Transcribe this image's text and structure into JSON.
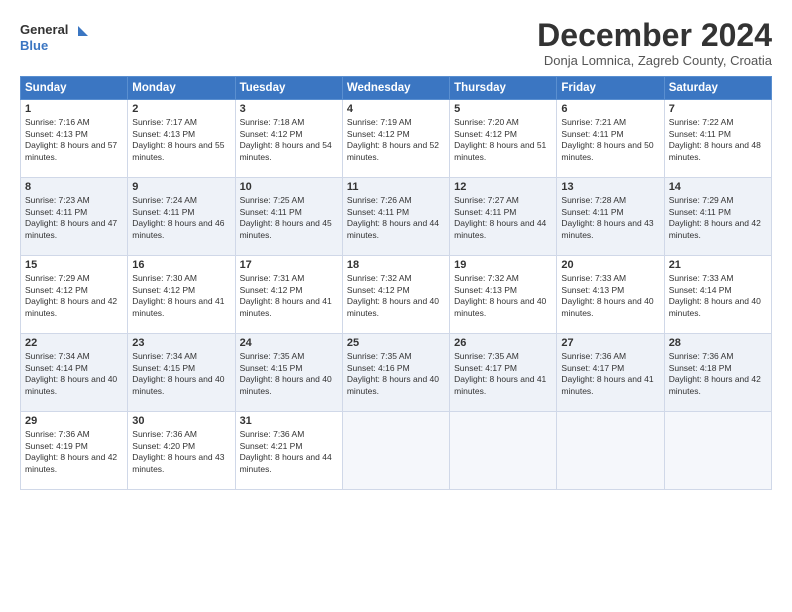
{
  "header": {
    "logo_line1": "General",
    "logo_line2": "Blue",
    "month_title": "December 2024",
    "location": "Donja Lomnica, Zagreb County, Croatia"
  },
  "weekdays": [
    "Sunday",
    "Monday",
    "Tuesday",
    "Wednesday",
    "Thursday",
    "Friday",
    "Saturday"
  ],
  "weeks": [
    [
      {
        "day": "1",
        "sunrise": "7:16 AM",
        "sunset": "4:13 PM",
        "daylight": "8 hours and 57 minutes."
      },
      {
        "day": "2",
        "sunrise": "7:17 AM",
        "sunset": "4:13 PM",
        "daylight": "8 hours and 55 minutes."
      },
      {
        "day": "3",
        "sunrise": "7:18 AM",
        "sunset": "4:12 PM",
        "daylight": "8 hours and 54 minutes."
      },
      {
        "day": "4",
        "sunrise": "7:19 AM",
        "sunset": "4:12 PM",
        "daylight": "8 hours and 52 minutes."
      },
      {
        "day": "5",
        "sunrise": "7:20 AM",
        "sunset": "4:12 PM",
        "daylight": "8 hours and 51 minutes."
      },
      {
        "day": "6",
        "sunrise": "7:21 AM",
        "sunset": "4:11 PM",
        "daylight": "8 hours and 50 minutes."
      },
      {
        "day": "7",
        "sunrise": "7:22 AM",
        "sunset": "4:11 PM",
        "daylight": "8 hours and 48 minutes."
      }
    ],
    [
      {
        "day": "8",
        "sunrise": "7:23 AM",
        "sunset": "4:11 PM",
        "daylight": "8 hours and 47 minutes."
      },
      {
        "day": "9",
        "sunrise": "7:24 AM",
        "sunset": "4:11 PM",
        "daylight": "8 hours and 46 minutes."
      },
      {
        "day": "10",
        "sunrise": "7:25 AM",
        "sunset": "4:11 PM",
        "daylight": "8 hours and 45 minutes."
      },
      {
        "day": "11",
        "sunrise": "7:26 AM",
        "sunset": "4:11 PM",
        "daylight": "8 hours and 44 minutes."
      },
      {
        "day": "12",
        "sunrise": "7:27 AM",
        "sunset": "4:11 PM",
        "daylight": "8 hours and 44 minutes."
      },
      {
        "day": "13",
        "sunrise": "7:28 AM",
        "sunset": "4:11 PM",
        "daylight": "8 hours and 43 minutes."
      },
      {
        "day": "14",
        "sunrise": "7:29 AM",
        "sunset": "4:11 PM",
        "daylight": "8 hours and 42 minutes."
      }
    ],
    [
      {
        "day": "15",
        "sunrise": "7:29 AM",
        "sunset": "4:12 PM",
        "daylight": "8 hours and 42 minutes."
      },
      {
        "day": "16",
        "sunrise": "7:30 AM",
        "sunset": "4:12 PM",
        "daylight": "8 hours and 41 minutes."
      },
      {
        "day": "17",
        "sunrise": "7:31 AM",
        "sunset": "4:12 PM",
        "daylight": "8 hours and 41 minutes."
      },
      {
        "day": "18",
        "sunrise": "7:32 AM",
        "sunset": "4:12 PM",
        "daylight": "8 hours and 40 minutes."
      },
      {
        "day": "19",
        "sunrise": "7:32 AM",
        "sunset": "4:13 PM",
        "daylight": "8 hours and 40 minutes."
      },
      {
        "day": "20",
        "sunrise": "7:33 AM",
        "sunset": "4:13 PM",
        "daylight": "8 hours and 40 minutes."
      },
      {
        "day": "21",
        "sunrise": "7:33 AM",
        "sunset": "4:14 PM",
        "daylight": "8 hours and 40 minutes."
      }
    ],
    [
      {
        "day": "22",
        "sunrise": "7:34 AM",
        "sunset": "4:14 PM",
        "daylight": "8 hours and 40 minutes."
      },
      {
        "day": "23",
        "sunrise": "7:34 AM",
        "sunset": "4:15 PM",
        "daylight": "8 hours and 40 minutes."
      },
      {
        "day": "24",
        "sunrise": "7:35 AM",
        "sunset": "4:15 PM",
        "daylight": "8 hours and 40 minutes."
      },
      {
        "day": "25",
        "sunrise": "7:35 AM",
        "sunset": "4:16 PM",
        "daylight": "8 hours and 40 minutes."
      },
      {
        "day": "26",
        "sunrise": "7:35 AM",
        "sunset": "4:17 PM",
        "daylight": "8 hours and 41 minutes."
      },
      {
        "day": "27",
        "sunrise": "7:36 AM",
        "sunset": "4:17 PM",
        "daylight": "8 hours and 41 minutes."
      },
      {
        "day": "28",
        "sunrise": "7:36 AM",
        "sunset": "4:18 PM",
        "daylight": "8 hours and 42 minutes."
      }
    ],
    [
      {
        "day": "29",
        "sunrise": "7:36 AM",
        "sunset": "4:19 PM",
        "daylight": "8 hours and 42 minutes."
      },
      {
        "day": "30",
        "sunrise": "7:36 AM",
        "sunset": "4:20 PM",
        "daylight": "8 hours and 43 minutes."
      },
      {
        "day": "31",
        "sunrise": "7:36 AM",
        "sunset": "4:21 PM",
        "daylight": "8 hours and 44 minutes."
      },
      null,
      null,
      null,
      null
    ]
  ]
}
